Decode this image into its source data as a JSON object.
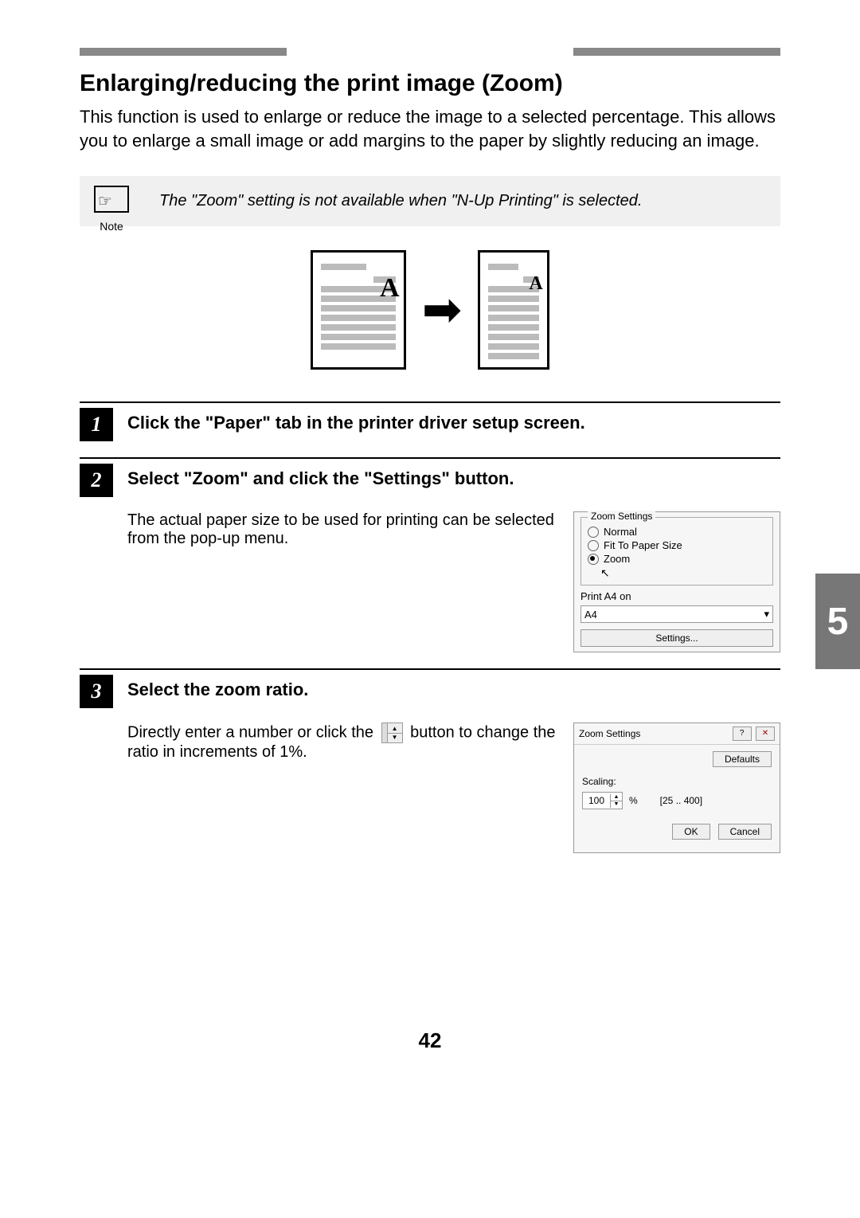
{
  "header": {
    "title": "Enlarging/reducing the print image (Zoom)",
    "intro": "This function is used to enlarge or reduce the image to a selected percentage. This allows you to enlarge a small image or add margins to the paper by slightly reducing an image."
  },
  "note": {
    "caption": "Note",
    "text": "The \"Zoom\" setting is not available when \"N-Up Printing\" is selected."
  },
  "steps": [
    {
      "num": "1",
      "title": "Click the \"Paper\" tab in the printer driver setup screen."
    },
    {
      "num": "2",
      "title": "Select \"Zoom\" and click the \"Settings\" button.",
      "text": "The actual paper size to be used for printing can be selected from the pop-up menu."
    },
    {
      "num": "3",
      "title": "Select the zoom ratio.",
      "text_a": "Directly enter a number or click the ",
      "text_b": " button to change the ratio in increments of 1%."
    }
  ],
  "panel1": {
    "group": "Zoom Settings",
    "opt_normal": "Normal",
    "opt_fit": "Fit To Paper Size",
    "opt_zoom": "Zoom",
    "print_on_label": "Print A4 on",
    "select_value": "A4",
    "settings_btn": "Settings..."
  },
  "panel2": {
    "title": "Zoom Settings",
    "defaults": "Defaults",
    "scaling_label": "Scaling:",
    "scaling_value": "100",
    "percent": "%",
    "range": "[25 .. 400]",
    "ok": "OK",
    "cancel": "Cancel"
  },
  "chapter_tab": "5",
  "page_number": "42"
}
